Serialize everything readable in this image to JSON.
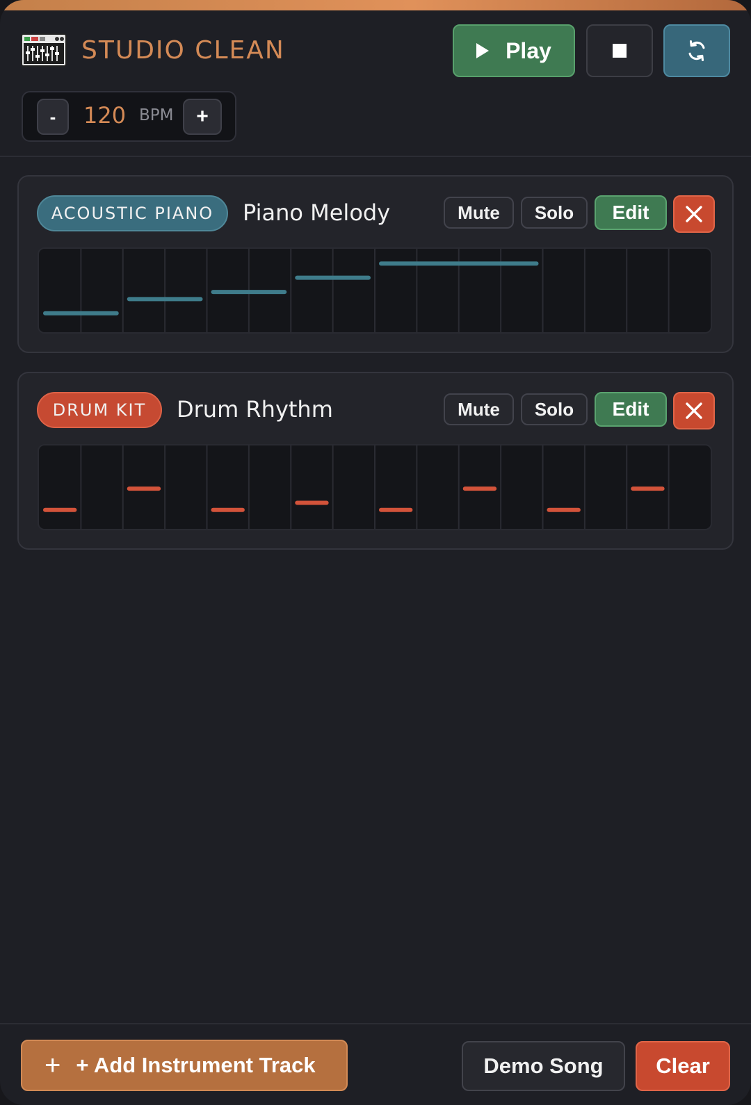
{
  "app": {
    "title": "STUDIO CLEAN",
    "logo_icon": "mixing-console-icon"
  },
  "transport": {
    "play_label": "Play",
    "play_icon": "play-icon",
    "stop_icon": "stop-icon",
    "loop_icon": "loop-icon"
  },
  "tempo": {
    "decrease_label": "-",
    "value": "120",
    "unit": "BPM",
    "increase_label": "+"
  },
  "colors": {
    "accent": "#d48a56",
    "play": "#3f7a52",
    "loop": "#37677a",
    "danger": "#c8492f",
    "piano_note": "#3f7c8b",
    "drum_note": "#d3533a"
  },
  "tracks": [
    {
      "instrument": "ACOUSTIC PIANO",
      "name": "Piano Melody",
      "mute_label": "Mute",
      "solo_label": "Solo",
      "edit_label": "Edit",
      "delete_icon": "close-icon",
      "badge_color": "#3a6d7e",
      "steps": 16,
      "notes": [
        {
          "start": 0,
          "length": 2,
          "pitch": 1
        },
        {
          "start": 2,
          "length": 2,
          "pitch": 3
        },
        {
          "start": 4,
          "length": 2,
          "pitch": 4
        },
        {
          "start": 6,
          "length": 2,
          "pitch": 6
        },
        {
          "start": 8,
          "length": 4,
          "pitch": 8
        }
      ]
    },
    {
      "instrument": "DRUM KIT",
      "name": "Drum Rhythm",
      "mute_label": "Mute",
      "solo_label": "Solo",
      "edit_label": "Edit",
      "delete_icon": "close-icon",
      "badge_color": "#c64a32",
      "steps": 16,
      "notes": [
        {
          "start": 0,
          "length": 1,
          "pitch": 1
        },
        {
          "start": 2,
          "length": 1,
          "pitch": 4
        },
        {
          "start": 4,
          "length": 1,
          "pitch": 1
        },
        {
          "start": 6,
          "length": 1,
          "pitch": 2
        },
        {
          "start": 8,
          "length": 1,
          "pitch": 1
        },
        {
          "start": 10,
          "length": 1,
          "pitch": 4
        },
        {
          "start": 12,
          "length": 1,
          "pitch": 1
        },
        {
          "start": 14,
          "length": 1,
          "pitch": 4
        }
      ]
    }
  ],
  "footer": {
    "add_label": "+ Add Instrument Track",
    "add_icon": "plus-icon",
    "demo_label": "Demo Song",
    "clear_label": "Clear"
  }
}
